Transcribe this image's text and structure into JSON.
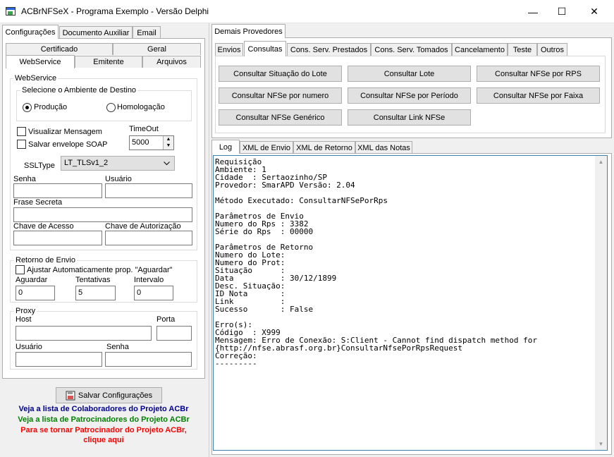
{
  "window": {
    "title": "ACBrNFSeX - Programa Exemplo - Versão Delphi",
    "minimize": "—",
    "maximize": "☐",
    "close": "✕"
  },
  "left_tabs": {
    "configuracoes": "Configurações",
    "documento_auxiliar": "Documento Auxiliar",
    "email": "Email"
  },
  "sub_tabs": {
    "certificado": "Certificado",
    "geral": "Geral",
    "webservice": "WebService",
    "emitente": "Emitente",
    "arquivos": "Arquivos"
  },
  "webservice": {
    "group_label": "WebService",
    "ambiente_label": "Selecione o Ambiente de Destino",
    "producao": "Produção",
    "homologacao": "Homologação",
    "visualizar_mensagem": "Visualizar Mensagem",
    "salvar_envelope": "Salvar envelope SOAP",
    "timeout_label": "TimeOut",
    "timeout_value": "5000",
    "ssltype_label": "SSLType",
    "ssltype_value": "LT_TLSv1_2",
    "senha_label": "Senha",
    "usuario_label": "Usuário",
    "frase_secreta_label": "Frase Secreta",
    "chave_acesso_label": "Chave de Acesso",
    "chave_autorizacao_label": "Chave de Autorização"
  },
  "retorno": {
    "group_label": "Retorno de Envio",
    "ajustar_label": "Ajustar Automaticamente prop. \"Aguardar\"",
    "aguardar_label": "Aguardar",
    "aguardar_value": "0",
    "tentativas_label": "Tentativas",
    "tentativas_value": "5",
    "intervalo_label": "Intervalo",
    "intervalo_value": "0"
  },
  "proxy": {
    "group_label": "Proxy",
    "host_label": "Host",
    "porta_label": "Porta",
    "usuario_label": "Usuário",
    "senha_label": "Senha"
  },
  "salvar_button": "Salvar Configurações",
  "links": {
    "colaboradores": "Veja a lista de Colaboradores do Projeto ACBr",
    "patrocinadores": "Veja a lista de Patrocinadores do Projeto ACBr",
    "tornar_line1": "Para se tornar Patrocinador do Projeto ACBr,",
    "tornar_line2": "clique aqui",
    "colors": {
      "colaboradores": "#00008b",
      "patrocinadores": "#008000",
      "tornar": "#ff0000"
    }
  },
  "right_top_tab": "Demais Provedores",
  "service_tabs": {
    "envios": "Envios",
    "consultas": "Consultas",
    "cons_prestados": "Cons. Serv. Prestados",
    "cons_tomados": "Cons. Serv. Tomados",
    "cancelamento": "Cancelamento",
    "teste": "Teste",
    "outros": "Outros"
  },
  "consultas_buttons": {
    "situacao_lote": "Consultar Situação do Lote",
    "lote": "Consultar Lote",
    "nfse_por_rps": "Consultar NFSe por RPS",
    "nfse_por_numero": "Consultar NFSe por numero",
    "nfse_por_periodo": "Consultar NFSe por Período",
    "nfse_por_faixa": "Consultar NFSe por Faixa",
    "nfse_generico": "Consultar NFSe Genérico",
    "link_nfse": "Consultar Link NFSe"
  },
  "log_tabs": {
    "log": "Log",
    "xml_envio": "XML de Envio",
    "xml_retorno": "XML de Retorno",
    "xml_notas": "XML das Notas"
  },
  "log_text": "Requisição\nAmbiente: 1\nCidade  : Sertaozinho/SP\nProvedor: SmarAPD Versão: 2.04\n\nMétodo Executado: ConsultarNFSePorRps\n\nParâmetros de Envio\nNumero do Rps : 3382\nSérie do Rps  : 00000\n\nParâmetros de Retorno\nNumero do Lote:\nNumero do Prot:\nSituação      :\nData          : 30/12/1899\nDesc. Situação:\nID Nota       :\nLink          :\nSucesso       : False\n\nErro(s):\nCódigo  : X999\nMensagem: Erro de Conexão: S:Client - Cannot find dispatch method for\n{http://nfse.abrasf.org.br}ConsultarNfsePorRpsRequest\nCorreção:\n---------",
  "scroll": {
    "up": "▲",
    "down": "▼"
  }
}
